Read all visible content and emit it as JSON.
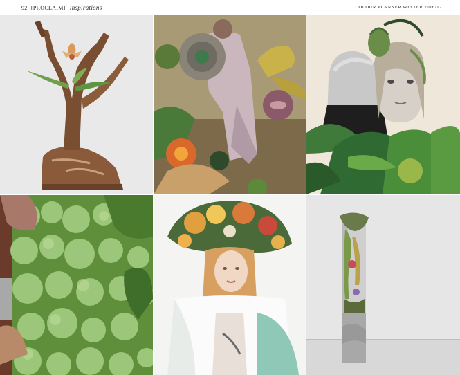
{
  "header": {
    "page_number": "92",
    "brand": "[PROCLAIM]",
    "section": "inspirations",
    "publication": "COLOUR PLANNER WINTER 2016/17"
  },
  "images": [
    {
      "id": "tree-sneaker",
      "kind": "photo"
    },
    {
      "id": "floral-collage",
      "kind": "collage"
    },
    {
      "id": "couple-foliage",
      "kind": "collage"
    },
    {
      "id": "moss-wall",
      "kind": "photo"
    },
    {
      "id": "flower-crown-portrait",
      "kind": "photo"
    },
    {
      "id": "plant-column",
      "kind": "photo"
    }
  ],
  "colors": {
    "background": "#ffffff",
    "text": "#2a2a2a",
    "moss_green": "#7fae5a",
    "wood_brown": "#7a4e30",
    "stone_grey": "#cfcfcf"
  }
}
